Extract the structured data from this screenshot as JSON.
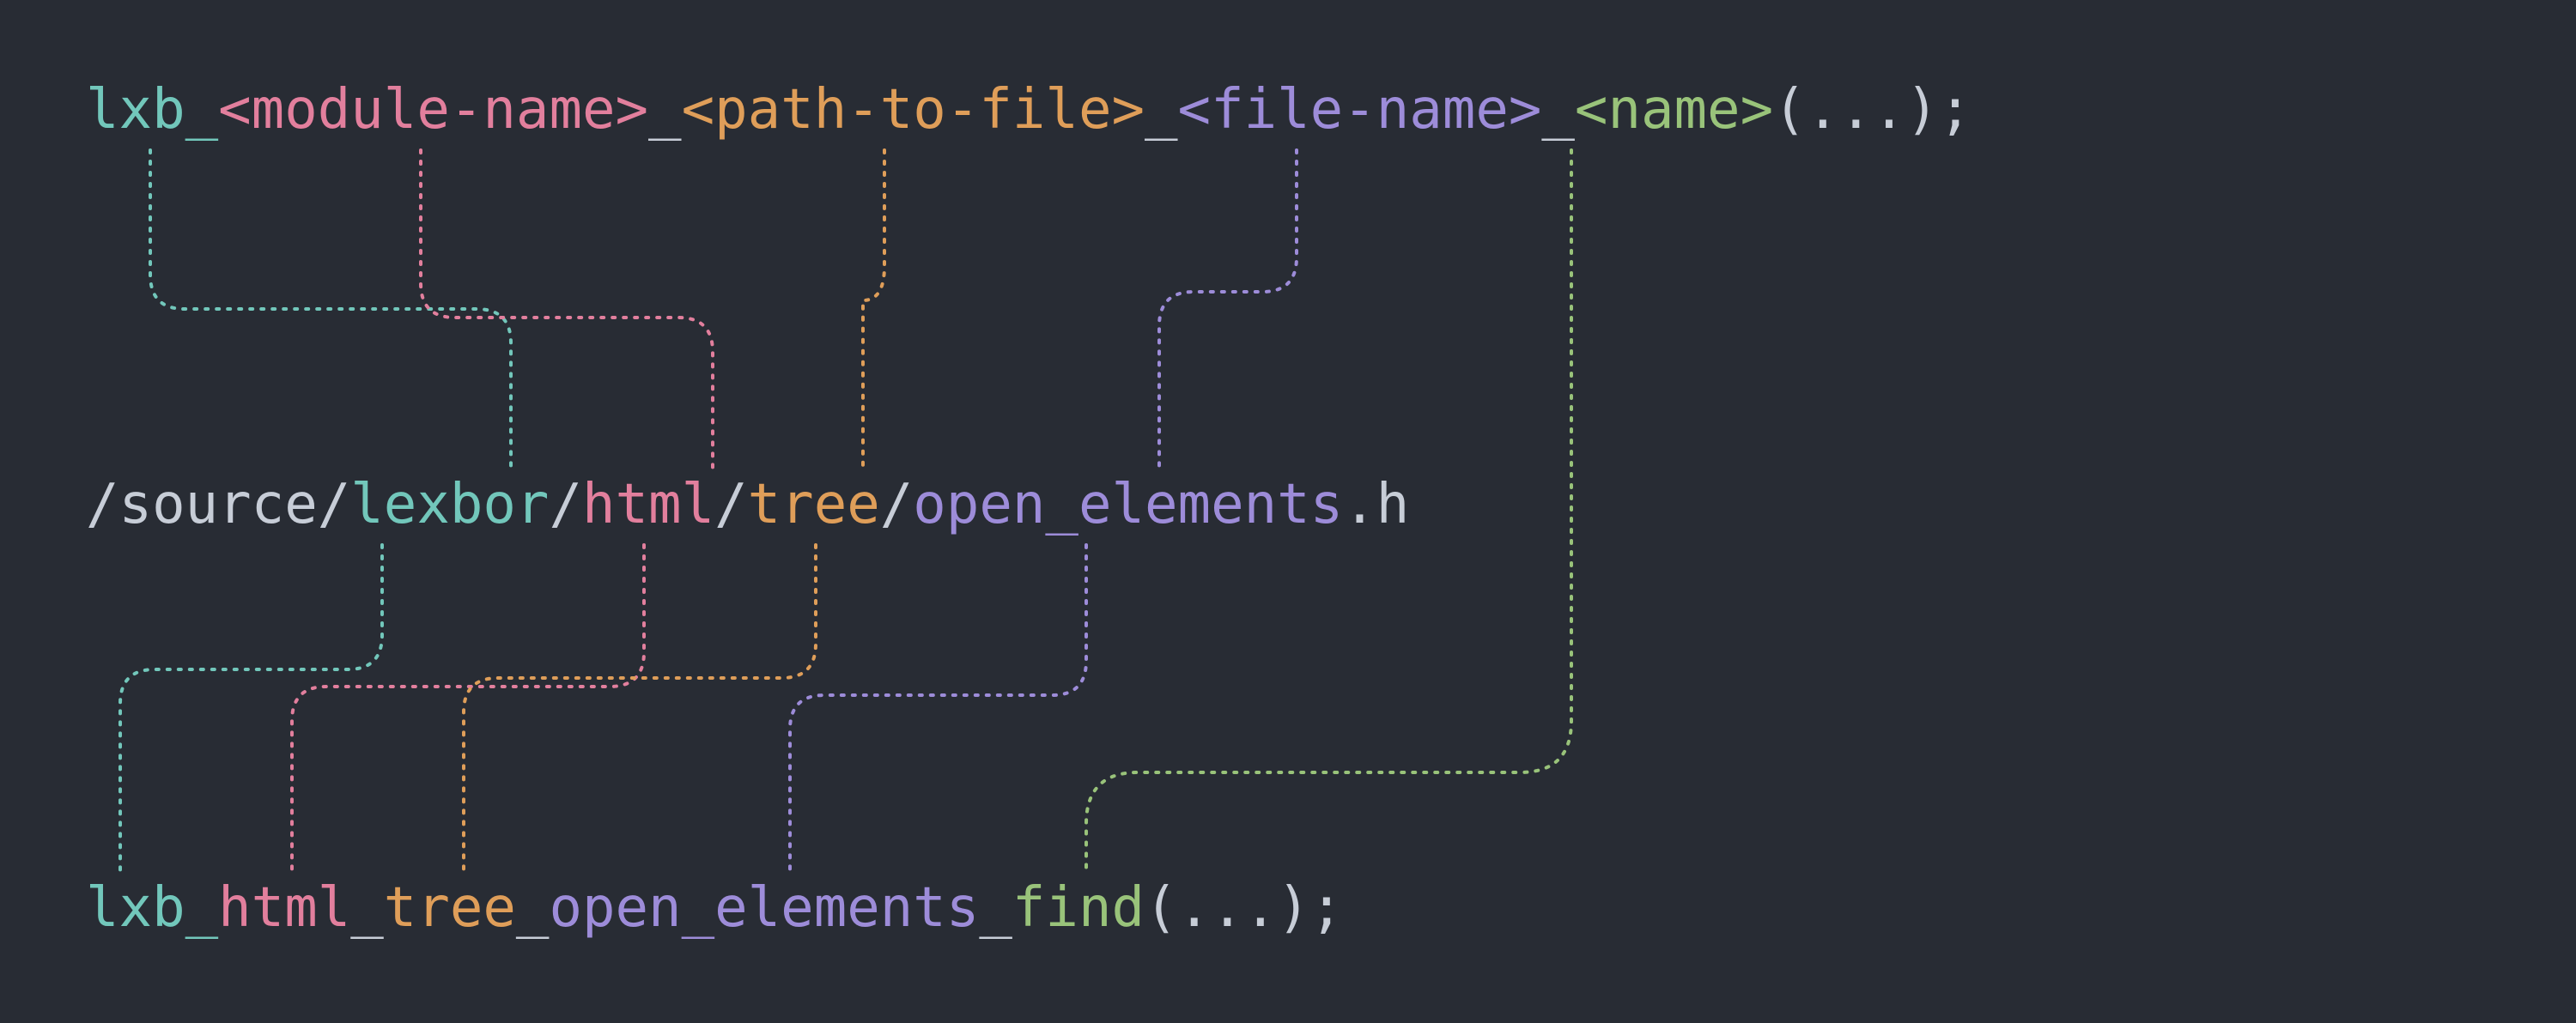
{
  "colors": {
    "background": "#282c34",
    "teal": "#72c7bb",
    "pink": "#e27f9d",
    "orange": "#df9e59",
    "purple": "#9d8cd9",
    "green": "#99c37a",
    "grey": "#c7cdd7"
  },
  "line1": {
    "prefix": "lxb_",
    "module": "<module-name>",
    "sep1": "_",
    "path": "<path-to-file>",
    "sep2": "_",
    "file": "<file-name>",
    "sep3": "_",
    "name": "<name>",
    "tail": "(...);"
  },
  "line2": {
    "p0": "/source/",
    "lexbor": "lexbor",
    "s1": "/",
    "html": "html",
    "s2": "/",
    "tree": "tree",
    "s3": "/",
    "openelems": "open_elements",
    "ext": ".h"
  },
  "line3": {
    "prefix": "lxb_",
    "html": "html",
    "u1": "_",
    "tree": "tree",
    "u2": "_",
    "openelems": "open_elements",
    "u3": "_",
    "find": "find",
    "tail": "(...);"
  }
}
